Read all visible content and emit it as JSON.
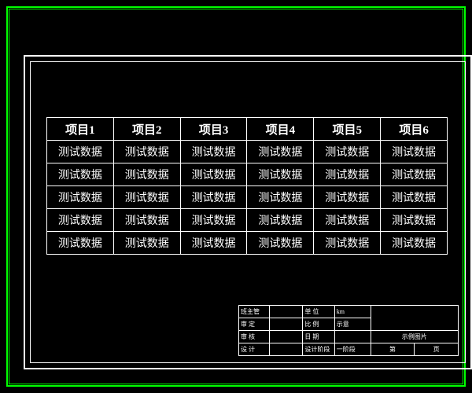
{
  "table": {
    "headers": [
      "项目1",
      "项目2",
      "项目3",
      "项目4",
      "项目5",
      "项目6"
    ],
    "rows": [
      [
        "测试数据",
        "测试数据",
        "测试数据",
        "测试数据",
        "测试数据",
        "测试数据"
      ],
      [
        "测试数据",
        "测试数据",
        "测试数据",
        "测试数据",
        "测试数据",
        "测试数据"
      ],
      [
        "测试数据",
        "测试数据",
        "测试数据",
        "测试数据",
        "测试数据",
        "测试数据"
      ],
      [
        "测试数据",
        "测试数据",
        "测试数据",
        "测试数据",
        "测试数据",
        "测试数据"
      ],
      [
        "测试数据",
        "测试数据",
        "测试数据",
        "测试数据",
        "测试数据",
        "测试数据"
      ]
    ]
  },
  "titleblock": {
    "r1c1": "班主管",
    "r1c2": "",
    "r1c3": "单 位",
    "r1c4": "km",
    "r2c1": "审 定",
    "r2c2": "",
    "r2c3": "比 例",
    "r2c4": "示意",
    "r3c1": "审 核",
    "r3c2": "",
    "r3c3": "日 期",
    "r3c4": "",
    "r4c1": "设 计",
    "r4c2": "",
    "r4c3": "设计阶段",
    "r4c4": "一阶段",
    "r4c5": "第",
    "r4c6": "页",
    "side1": "",
    "side2": "示例图片",
    "side3": ""
  }
}
